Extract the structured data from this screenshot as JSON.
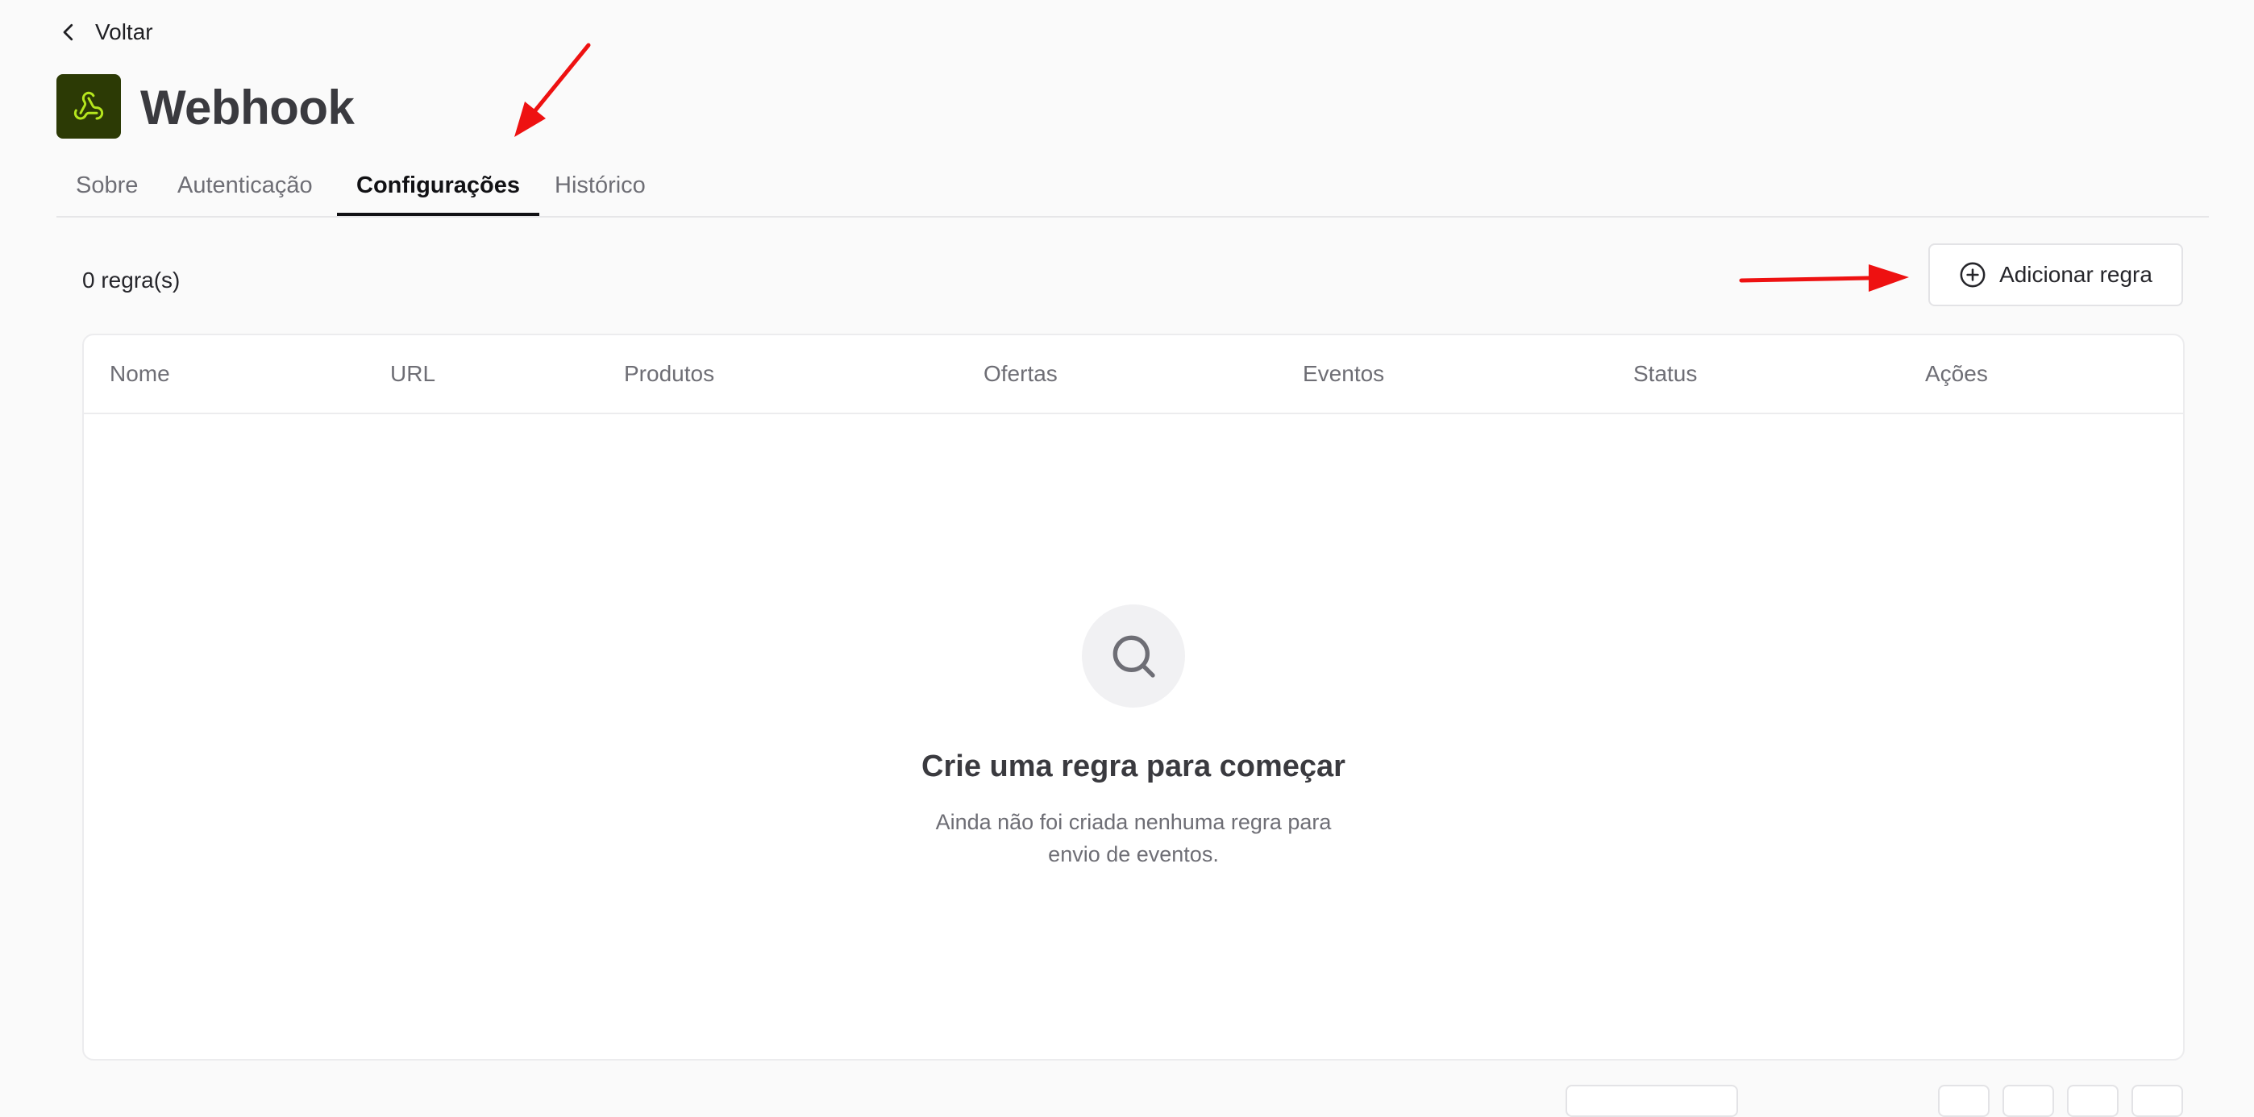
{
  "nav": {
    "back_label": "Voltar"
  },
  "header": {
    "title": "Webhook",
    "icon": "webhook-icon",
    "icon_bg": "#2c3a05",
    "icon_color": "#b5e61d"
  },
  "tabs": [
    {
      "label": "Sobre",
      "active": false
    },
    {
      "label": "Autenticação",
      "active": false
    },
    {
      "label": "Configurações",
      "active": true
    },
    {
      "label": "Histórico",
      "active": false
    }
  ],
  "toolbar": {
    "count_label": "0 regra(s)",
    "add_button_label": "Adicionar regra",
    "add_icon": "plus-circle-icon"
  },
  "table": {
    "columns": [
      "Nome",
      "URL",
      "Produtos",
      "Ofertas",
      "Eventos",
      "Status",
      "Ações"
    ],
    "rows": []
  },
  "empty_state": {
    "icon": "search-icon",
    "title": "Crie uma regra para começar",
    "description": "Ainda não foi criada nenhuma regra para envio de eventos."
  },
  "annotations": {
    "arrow_color": "#ee1111"
  }
}
